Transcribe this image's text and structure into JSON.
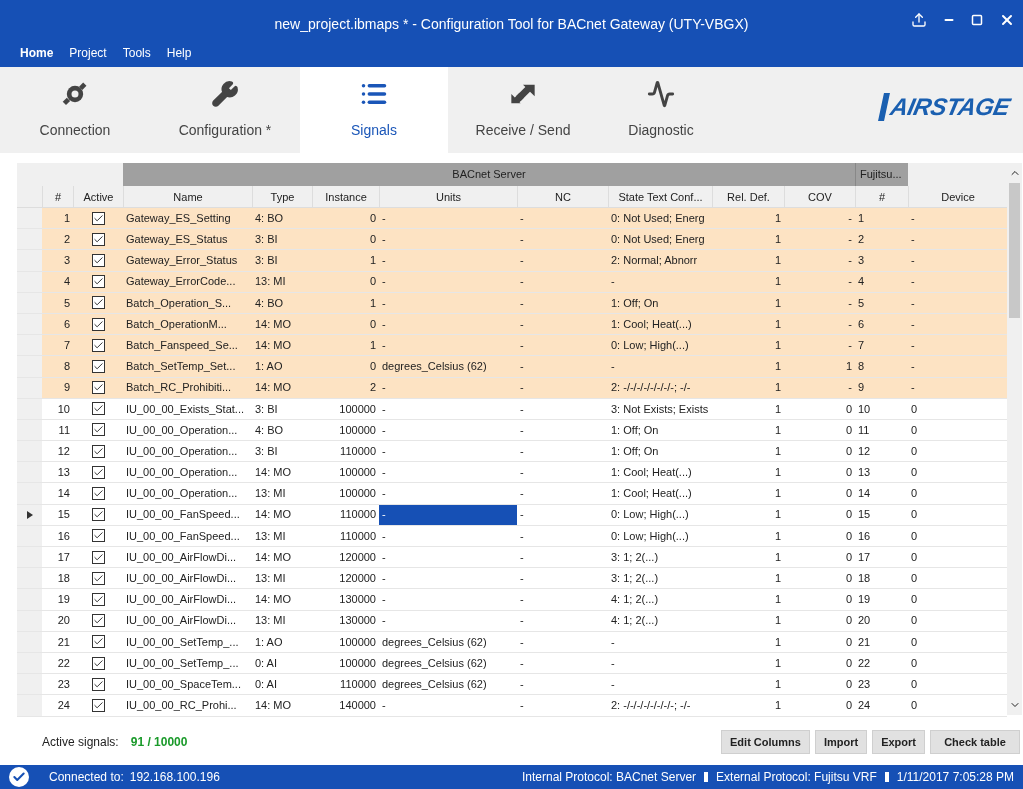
{
  "window": {
    "title": "new_project.ibmaps * - Configuration Tool for BACnet Gateway (UTY-VBGX)"
  },
  "menu": [
    {
      "label": "Home",
      "selected": true
    },
    {
      "label": "Project",
      "selected": false
    },
    {
      "label": "Tools",
      "selected": false
    },
    {
      "label": "Help",
      "selected": false
    }
  ],
  "tabs": [
    {
      "label": "Connection",
      "selected": false
    },
    {
      "label": "Configuration *",
      "selected": false
    },
    {
      "label": "Signals",
      "selected": true
    },
    {
      "label": "Receive / Send",
      "selected": false
    },
    {
      "label": "Diagnostic",
      "selected": false
    }
  ],
  "logo": "AIRSTAGE",
  "table": {
    "groups": [
      "BACnet Server",
      "Fujitsu..."
    ],
    "columns": [
      "#",
      "Active",
      "Name",
      "Type",
      "Instance",
      "Units",
      "NC",
      "State Text Conf...",
      "Rel. Def.",
      "COV",
      "#",
      "Device"
    ],
    "rows": [
      {
        "num": "1",
        "active": true,
        "name": "Gateway_ES_Setting",
        "type": "4: BO",
        "instance": "0",
        "units": "-",
        "nc": "-",
        "state_text": "0: Not Used; Energ",
        "rel_def": "1",
        "cov": "-",
        "fnum": "1",
        "device": "-",
        "highlighted": true,
        "selected": false
      },
      {
        "num": "2",
        "active": true,
        "name": "Gateway_ES_Status",
        "type": "3: BI",
        "instance": "0",
        "units": "-",
        "nc": "-",
        "state_text": "0: Not Used; Energ",
        "rel_def": "1",
        "cov": "-",
        "fnum": "2",
        "device": "-",
        "highlighted": true,
        "selected": false
      },
      {
        "num": "3",
        "active": true,
        "name": "Gateway_Error_Status",
        "type": "3: BI",
        "instance": "1",
        "units": "-",
        "nc": "-",
        "state_text": "2: Normal; Abnorr",
        "rel_def": "1",
        "cov": "-",
        "fnum": "3",
        "device": "-",
        "highlighted": true,
        "selected": false
      },
      {
        "num": "4",
        "active": true,
        "name": "Gateway_ErrorCode...",
        "type": "13: MI",
        "instance": "0",
        "units": "-",
        "nc": "-",
        "state_text": "-",
        "rel_def": "1",
        "cov": "-",
        "fnum": "4",
        "device": "-",
        "highlighted": true,
        "selected": false
      },
      {
        "num": "5",
        "active": true,
        "name": "Batch_Operation_S...",
        "type": "4: BO",
        "instance": "1",
        "units": "-",
        "nc": "-",
        "state_text": "1: Off; On",
        "rel_def": "1",
        "cov": "-",
        "fnum": "5",
        "device": "-",
        "highlighted": true,
        "selected": false
      },
      {
        "num": "6",
        "active": true,
        "name": "Batch_OperationM...",
        "type": "14: MO",
        "instance": "0",
        "units": "-",
        "nc": "-",
        "state_text": "1: Cool; Heat(...)",
        "rel_def": "1",
        "cov": "-",
        "fnum": "6",
        "device": "-",
        "highlighted": true,
        "selected": false
      },
      {
        "num": "7",
        "active": true,
        "name": "Batch_Fanspeed_Se...",
        "type": "14: MO",
        "instance": "1",
        "units": "-",
        "nc": "-",
        "state_text": "0: Low; High(...)",
        "rel_def": "1",
        "cov": "-",
        "fnum": "7",
        "device": "-",
        "highlighted": true,
        "selected": false
      },
      {
        "num": "8",
        "active": true,
        "name": "Batch_SetTemp_Set...",
        "type": "1: AO",
        "instance": "0",
        "units": "degrees_Celsius (62)",
        "nc": "-",
        "state_text": "-",
        "rel_def": "1",
        "cov": "1",
        "fnum": "8",
        "device": "-",
        "highlighted": true,
        "selected": false
      },
      {
        "num": "9",
        "active": true,
        "name": "Batch_RC_Prohibiti...",
        "type": "14: MO",
        "instance": "2",
        "units": "-",
        "nc": "-",
        "state_text": "2: -/-/-/-/-/-/-/-; -/-",
        "rel_def": "1",
        "cov": "-",
        "fnum": "9",
        "device": "-",
        "highlighted": true,
        "selected": false
      },
      {
        "num": "10",
        "active": true,
        "name": "IU_00_00_Exists_Stat...",
        "type": "3: BI",
        "instance": "100000",
        "units": "-",
        "nc": "-",
        "state_text": "3: Not Exists; Exists",
        "rel_def": "1",
        "cov": "0",
        "fnum": "10",
        "device": "0",
        "highlighted": false,
        "selected": false
      },
      {
        "num": "11",
        "active": true,
        "name": "IU_00_00_Operation...",
        "type": "4: BO",
        "instance": "100000",
        "units": "-",
        "nc": "-",
        "state_text": "1: Off; On",
        "rel_def": "1",
        "cov": "0",
        "fnum": "11",
        "device": "0",
        "highlighted": false,
        "selected": false
      },
      {
        "num": "12",
        "active": true,
        "name": "IU_00_00_Operation...",
        "type": "3: BI",
        "instance": "110000",
        "units": "-",
        "nc": "-",
        "state_text": "1: Off; On",
        "rel_def": "1",
        "cov": "0",
        "fnum": "12",
        "device": "0",
        "highlighted": false,
        "selected": false
      },
      {
        "num": "13",
        "active": true,
        "name": "IU_00_00_Operation...",
        "type": "14: MO",
        "instance": "100000",
        "units": "-",
        "nc": "-",
        "state_text": "1: Cool; Heat(...)",
        "rel_def": "1",
        "cov": "0",
        "fnum": "13",
        "device": "0",
        "highlighted": false,
        "selected": false
      },
      {
        "num": "14",
        "active": true,
        "name": "IU_00_00_Operation...",
        "type": "13: MI",
        "instance": "100000",
        "units": "-",
        "nc": "-",
        "state_text": "1: Cool; Heat(...)",
        "rel_def": "1",
        "cov": "0",
        "fnum": "14",
        "device": "0",
        "highlighted": false,
        "selected": false
      },
      {
        "num": "15",
        "active": true,
        "name": "IU_00_00_FanSpeed...",
        "type": "14: MO",
        "instance": "110000",
        "units": "-",
        "nc": "-",
        "state_text": "0: Low; High(...)",
        "rel_def": "1",
        "cov": "0",
        "fnum": "15",
        "device": "0",
        "highlighted": false,
        "selected": true
      },
      {
        "num": "16",
        "active": true,
        "name": "IU_00_00_FanSpeed...",
        "type": "13: MI",
        "instance": "110000",
        "units": "-",
        "nc": "-",
        "state_text": "0: Low; High(...)",
        "rel_def": "1",
        "cov": "0",
        "fnum": "16",
        "device": "0",
        "highlighted": false,
        "selected": false
      },
      {
        "num": "17",
        "active": true,
        "name": "IU_00_00_AirFlowDi...",
        "type": "14: MO",
        "instance": "120000",
        "units": "-",
        "nc": "-",
        "state_text": "3: 1; 2(...)",
        "rel_def": "1",
        "cov": "0",
        "fnum": "17",
        "device": "0",
        "highlighted": false,
        "selected": false
      },
      {
        "num": "18",
        "active": true,
        "name": "IU_00_00_AirFlowDi...",
        "type": "13: MI",
        "instance": "120000",
        "units": "-",
        "nc": "-",
        "state_text": "3: 1; 2(...)",
        "rel_def": "1",
        "cov": "0",
        "fnum": "18",
        "device": "0",
        "highlighted": false,
        "selected": false
      },
      {
        "num": "19",
        "active": true,
        "name": "IU_00_00_AirFlowDi...",
        "type": "14: MO",
        "instance": "130000",
        "units": "-",
        "nc": "-",
        "state_text": "4: 1; 2(...)",
        "rel_def": "1",
        "cov": "0",
        "fnum": "19",
        "device": "0",
        "highlighted": false,
        "selected": false
      },
      {
        "num": "20",
        "active": true,
        "name": "IU_00_00_AirFlowDi...",
        "type": "13: MI",
        "instance": "130000",
        "units": "-",
        "nc": "-",
        "state_text": "4: 1; 2(...)",
        "rel_def": "1",
        "cov": "0",
        "fnum": "20",
        "device": "0",
        "highlighted": false,
        "selected": false
      },
      {
        "num": "21",
        "active": true,
        "name": "IU_00_00_SetTemp_...",
        "type": "1: AO",
        "instance": "100000",
        "units": "degrees_Celsius (62)",
        "nc": "-",
        "state_text": "-",
        "rel_def": "1",
        "cov": "0",
        "fnum": "21",
        "device": "0",
        "highlighted": false,
        "selected": false
      },
      {
        "num": "22",
        "active": true,
        "name": "IU_00_00_SetTemp_...",
        "type": "0: AI",
        "instance": "100000",
        "units": "degrees_Celsius (62)",
        "nc": "-",
        "state_text": "-",
        "rel_def": "1",
        "cov": "0",
        "fnum": "22",
        "device": "0",
        "highlighted": false,
        "selected": false
      },
      {
        "num": "23",
        "active": true,
        "name": "IU_00_00_SpaceTem...",
        "type": "0: AI",
        "instance": "110000",
        "units": "degrees_Celsius (62)",
        "nc": "-",
        "state_text": "-",
        "rel_def": "1",
        "cov": "0",
        "fnum": "23",
        "device": "0",
        "highlighted": false,
        "selected": false
      },
      {
        "num": "24",
        "active": true,
        "name": "IU_00_00_RC_Prohi...",
        "type": "14: MO",
        "instance": "140000",
        "units": "-",
        "nc": "-",
        "state_text": "2: -/-/-/-/-/-/-/-; -/-",
        "rel_def": "1",
        "cov": "0",
        "fnum": "24",
        "device": "0",
        "highlighted": false,
        "selected": false
      }
    ]
  },
  "footer": {
    "label": "Active signals:",
    "value": "91 / 10000",
    "buttons": [
      "Edit Columns",
      "Import",
      "Export",
      "Check table"
    ]
  },
  "status_bar": {
    "connected_label": "Connected to:",
    "address": "192.168.100.196",
    "internal": "Internal Protocol: BACnet Server",
    "external": "External Protocol: Fujitsu VRF",
    "time": "1/11/2017 7:05:28 PM"
  }
}
